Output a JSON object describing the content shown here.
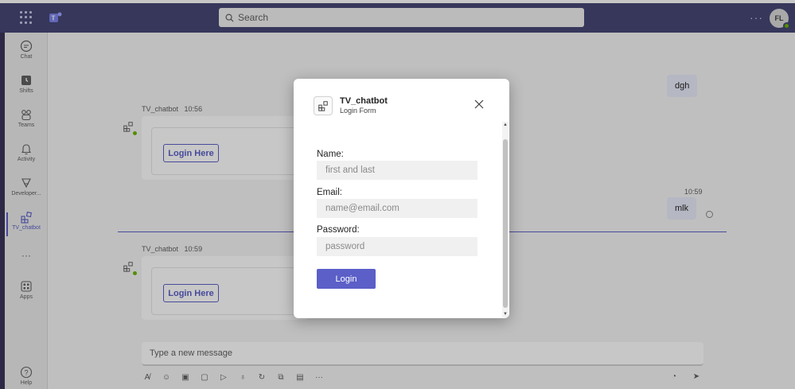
{
  "topbar": {
    "search_placeholder": "Search",
    "avatar_initials": "FL",
    "more_label": "···"
  },
  "rail": {
    "items": [
      {
        "label": "Chat",
        "icon": "chat-icon"
      },
      {
        "label": "Shifts",
        "icon": "shifts-icon"
      },
      {
        "label": "Teams",
        "icon": "teams-icon"
      },
      {
        "label": "Activity",
        "icon": "bell-icon"
      },
      {
        "label": "Developer...",
        "icon": "developer-icon"
      },
      {
        "label": "TV_chatbot",
        "icon": "app-icon"
      },
      {
        "label": "···",
        "icon": "more-icon"
      },
      {
        "label": "Apps",
        "icon": "apps-icon"
      },
      {
        "label": "Help",
        "icon": "help-icon"
      }
    ],
    "active": "TV_chatbot"
  },
  "chat": {
    "messages": [
      {
        "sender": "TV_chatbot",
        "time": "10:56",
        "card_button": "Login Here"
      },
      {
        "sender": "TV_chatbot",
        "time": "10:59",
        "card_button": "Login Here"
      }
    ],
    "my_messages": [
      {
        "text": "dgh"
      },
      {
        "time": "10:59",
        "text": "mlk"
      }
    ],
    "composer_placeholder": "Type a new message"
  },
  "modal": {
    "title": "TV_chatbot",
    "subtitle": "Login Form",
    "fields": [
      {
        "label": "Name:",
        "placeholder": "first and last"
      },
      {
        "label": "Email:",
        "placeholder": "name@email.com"
      },
      {
        "label": "Password:",
        "placeholder": "password"
      }
    ],
    "submit_label": "Login"
  },
  "colors": {
    "topbar": "#464775",
    "accent": "#5b5fc7",
    "presence": "#6bb700"
  }
}
